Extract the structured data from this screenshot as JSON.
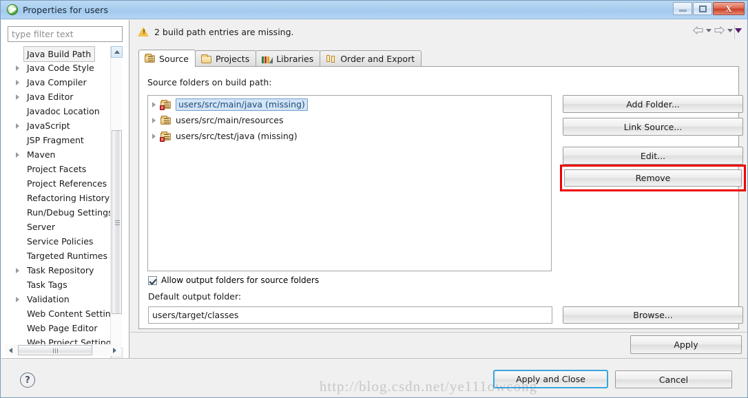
{
  "window": {
    "title": "Properties for users",
    "app_icon": "eclipse-icon",
    "controls": {
      "minimize": "minimize-button",
      "maximize": "maximize-button",
      "close": "close-button",
      "close_glyph": "X"
    }
  },
  "sidebar": {
    "filter": {
      "placeholder": "type filter text",
      "value": ""
    },
    "items": [
      {
        "label": "Java Build Path",
        "expandable": false,
        "selected": true
      },
      {
        "label": "Java Code Style",
        "expandable": true,
        "selected": false
      },
      {
        "label": "Java Compiler",
        "expandable": true,
        "selected": false
      },
      {
        "label": "Java Editor",
        "expandable": true,
        "selected": false
      },
      {
        "label": "Javadoc Location",
        "expandable": false,
        "selected": false
      },
      {
        "label": "JavaScript",
        "expandable": true,
        "selected": false
      },
      {
        "label": "JSP Fragment",
        "expandable": false,
        "selected": false
      },
      {
        "label": "Maven",
        "expandable": true,
        "selected": false
      },
      {
        "label": "Project Facets",
        "expandable": false,
        "selected": false
      },
      {
        "label": "Project References",
        "expandable": false,
        "selected": false
      },
      {
        "label": "Refactoring History",
        "expandable": false,
        "selected": false
      },
      {
        "label": "Run/Debug Settings",
        "expandable": false,
        "selected": false
      },
      {
        "label": "Server",
        "expandable": false,
        "selected": false
      },
      {
        "label": "Service Policies",
        "expandable": false,
        "selected": false
      },
      {
        "label": "Targeted Runtimes",
        "expandable": false,
        "selected": false
      },
      {
        "label": "Task Repository",
        "expandable": true,
        "selected": false
      },
      {
        "label": "Task Tags",
        "expandable": false,
        "selected": false
      },
      {
        "label": "Validation",
        "expandable": true,
        "selected": false
      },
      {
        "label": "Web Content Settings",
        "expandable": false,
        "selected": false
      },
      {
        "label": "Web Page Editor",
        "expandable": false,
        "selected": false
      },
      {
        "label": "Web Project Settings",
        "expandable": false,
        "selected": false
      }
    ]
  },
  "message_bar": {
    "icon": "warning-icon",
    "text": "2 build path entries are missing.",
    "nav": {
      "back": "back-arrow",
      "back_menu": "back-dropdown",
      "forward": "forward-arrow",
      "forward_menu": "forward-dropdown",
      "more": "view-menu"
    }
  },
  "tabs": [
    {
      "label": "Source",
      "icon": "package-folder-icon",
      "active": true
    },
    {
      "label": "Projects",
      "icon": "open-folder-icon",
      "active": false
    },
    {
      "label": "Libraries",
      "icon": "library-books-icon",
      "active": false
    },
    {
      "label": "Order and Export",
      "icon": "up-down-arrows-icon",
      "active": false
    }
  ],
  "source_tab": {
    "list_label": "Source folders on build path:",
    "entries": [
      {
        "text": "users/src/main/java (missing)",
        "icon": "package-folder-error-icon",
        "selected": true
      },
      {
        "text": "users/src/main/resources",
        "icon": "package-folder-icon",
        "selected": false
      },
      {
        "text": "users/src/test/java (missing)",
        "icon": "package-folder-error-icon",
        "selected": false
      }
    ],
    "buttons": {
      "add_folder": "Add Folder...",
      "link_source": "Link Source...",
      "edit": "Edit...",
      "remove": "Remove",
      "browse": "Browse..."
    },
    "highlight": {
      "target": "Remove",
      "color": "#ee0000"
    },
    "allow_output_checkbox": {
      "label": "Allow output folders for source folders",
      "checked": true
    },
    "default_output_label": "Default output folder:",
    "default_output_value": "users/target/classes"
  },
  "footer": {
    "apply": "Apply",
    "help": "?",
    "apply_and_close": "Apply and Close",
    "cancel": "Cancel"
  },
  "watermark": "http://blog.csdn.net/ye111owcong"
}
